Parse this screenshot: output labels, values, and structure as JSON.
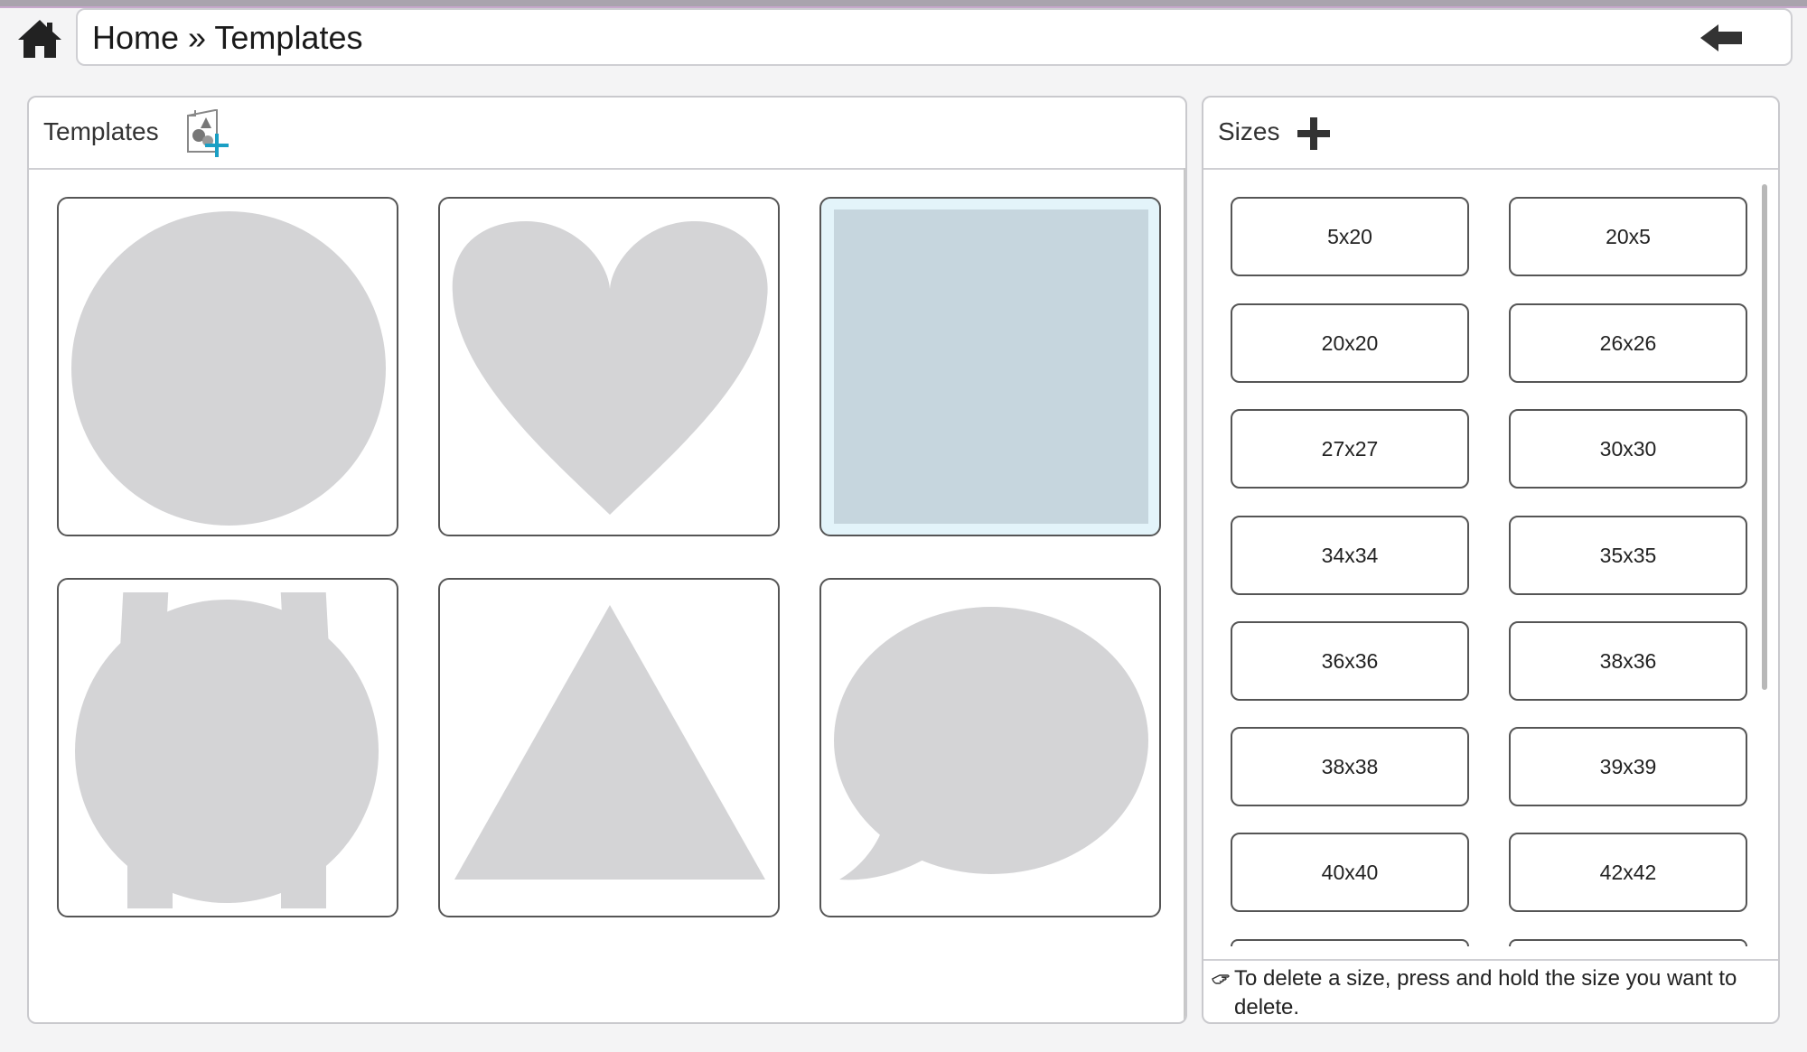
{
  "breadcrumb": {
    "home": "Home",
    "separator": " » ",
    "current": "Templates"
  },
  "templates_panel": {
    "title": "Templates",
    "items": [
      {
        "shape": "circle",
        "selected": false
      },
      {
        "shape": "heart",
        "selected": false
      },
      {
        "shape": "square",
        "selected": true
      },
      {
        "shape": "watch",
        "selected": false
      },
      {
        "shape": "triangle",
        "selected": false
      },
      {
        "shape": "speech-bubble",
        "selected": false
      }
    ]
  },
  "sizes_panel": {
    "title": "Sizes",
    "sizes": [
      "5x20",
      "20x5",
      "20x20",
      "26x26",
      "27x27",
      "30x30",
      "34x34",
      "35x35",
      "36x36",
      "38x36",
      "38x38",
      "39x39",
      "40x40",
      "42x42"
    ],
    "hint": "To delete a size, press and hold the size you want to delete."
  },
  "colors": {
    "shape_fill": "#d4d4d6",
    "selected_tile_bg": "#e3f4fa",
    "selected_shape_fill": "#c6d6de",
    "accent": "#1a9fc4"
  }
}
